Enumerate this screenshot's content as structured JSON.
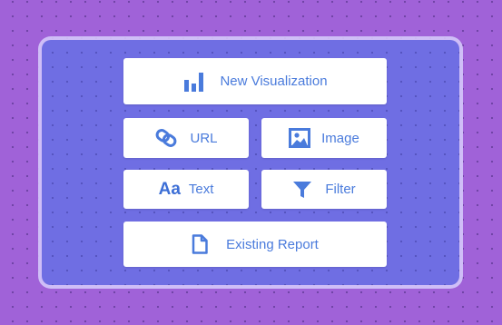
{
  "menu": {
    "new_visualization": {
      "label": "New Visualization",
      "icon": "bar-chart-icon"
    },
    "url": {
      "label": "URL",
      "icon": "link-icon"
    },
    "image": {
      "label": "Image",
      "icon": "image-icon"
    },
    "text": {
      "label": "Text",
      "icon_text": "Aa"
    },
    "filter": {
      "label": "Filter",
      "icon": "filter-icon"
    },
    "existing_report": {
      "label": "Existing Report",
      "icon": "document-icon"
    }
  },
  "colors": {
    "background": "#a062d8",
    "panel": "#6f6ee3",
    "button": "#ffffff",
    "accent": "#4a7bdc"
  }
}
